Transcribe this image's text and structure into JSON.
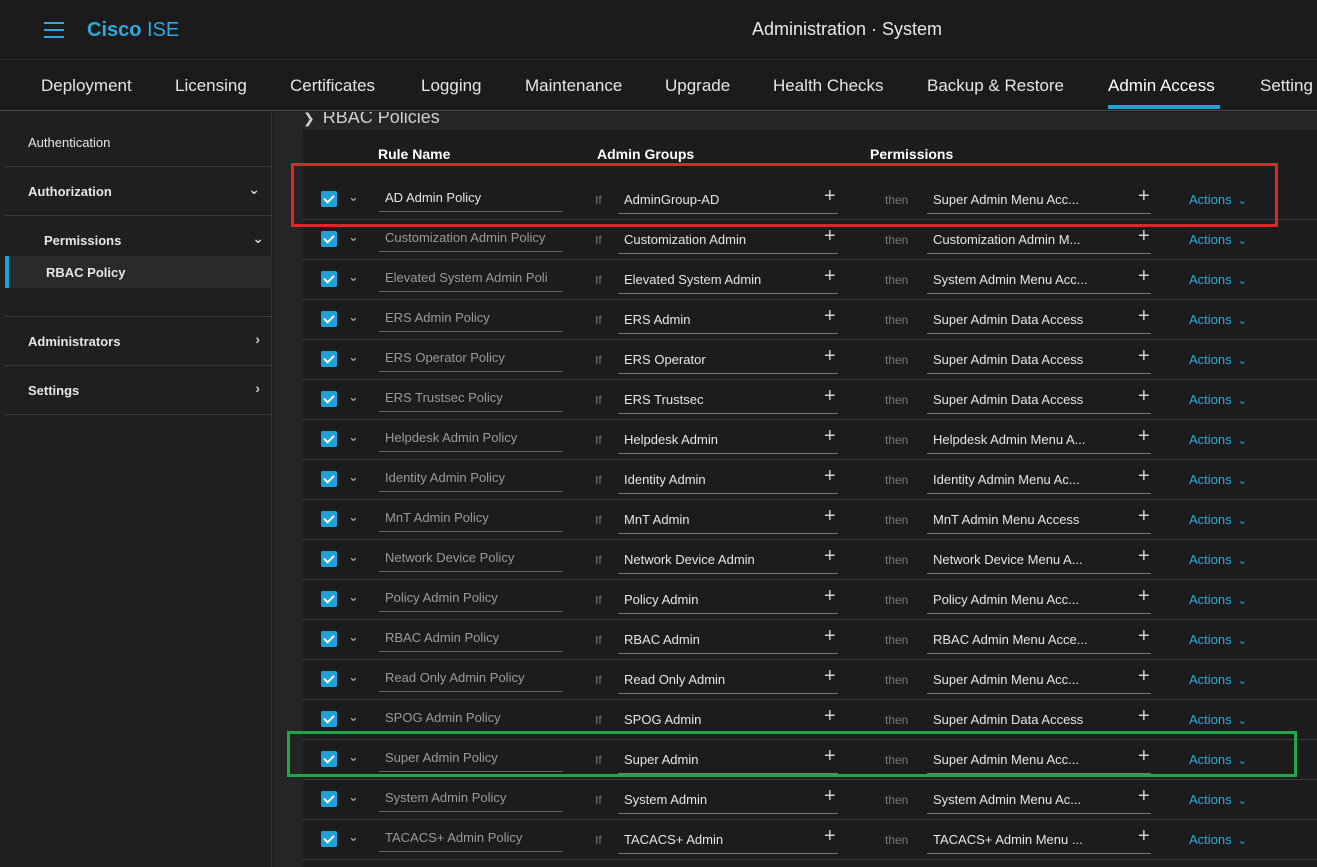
{
  "header": {
    "brand_bold": "Cisco",
    "brand_rest": "ISE",
    "title": "Administration · System"
  },
  "tabs": [
    {
      "label": "Deployment"
    },
    {
      "label": "Licensing"
    },
    {
      "label": "Certificates"
    },
    {
      "label": "Logging"
    },
    {
      "label": "Maintenance"
    },
    {
      "label": "Upgrade"
    },
    {
      "label": "Health Checks"
    },
    {
      "label": "Backup & Restore"
    },
    {
      "label": "Admin Access",
      "active": true
    },
    {
      "label": "Setting"
    }
  ],
  "sidebar": {
    "authentication": "Authentication",
    "authorization": "Authorization",
    "permissions": "Permissions",
    "rbac_policy": "RBAC Policy",
    "administrators": "Administrators",
    "settings": "Settings"
  },
  "main": {
    "section_title": "RBAC Policies",
    "columns": {
      "rule_name": "Rule Name",
      "admin_groups": "Admin Groups",
      "permissions": "Permissions"
    },
    "if_label": "If",
    "then_label": "then",
    "actions_label": "Actions",
    "rows": [
      {
        "name": "AD Admin Policy",
        "group": "AdminGroup-AD",
        "permission": "Super Admin Menu Acc...",
        "highlight": true
      },
      {
        "name": "Customization Admin Policy",
        "group": "Customization Admin",
        "permission": "Customization Admin M..."
      },
      {
        "name": "Elevated System Admin Poli",
        "group": "Elevated System Admin",
        "permission": "System Admin Menu Acc..."
      },
      {
        "name": "ERS Admin Policy",
        "group": "ERS Admin",
        "permission": "Super Admin Data Access"
      },
      {
        "name": "ERS Operator Policy",
        "group": "ERS Operator",
        "permission": "Super Admin Data Access"
      },
      {
        "name": "ERS Trustsec Policy",
        "group": "ERS Trustsec",
        "permission": "Super Admin Data Access"
      },
      {
        "name": "Helpdesk Admin Policy",
        "group": "Helpdesk Admin",
        "permission": "Helpdesk Admin Menu A..."
      },
      {
        "name": "Identity Admin Policy",
        "group": "Identity Admin",
        "permission": "Identity Admin Menu Ac..."
      },
      {
        "name": "MnT Admin Policy",
        "group": "MnT Admin",
        "permission": "MnT Admin Menu Access"
      },
      {
        "name": "Network Device Policy",
        "group": "Network Device Admin",
        "permission": "Network Device Menu A..."
      },
      {
        "name": "Policy Admin Policy",
        "group": "Policy Admin",
        "permission": "Policy Admin Menu Acc..."
      },
      {
        "name": "RBAC Admin Policy",
        "group": "RBAC Admin",
        "permission": "RBAC Admin Menu Acce..."
      },
      {
        "name": "Read Only Admin Policy",
        "group": "Read Only Admin",
        "permission": "Super Admin Menu Acc..."
      },
      {
        "name": "SPOG Admin Policy",
        "group": "SPOG Admin",
        "permission": "Super Admin Data Access"
      },
      {
        "name": "Super Admin Policy",
        "group": "Super Admin",
        "permission": "Super Admin Menu Acc..."
      },
      {
        "name": "System Admin Policy",
        "group": "System Admin",
        "permission": "System Admin Menu Ac..."
      },
      {
        "name": "TACACS+ Admin Policy",
        "group": "TACACS+ Admin",
        "permission": "TACACS+ Admin Menu ..."
      }
    ]
  },
  "colors": {
    "accent": "#1ea0d8",
    "highlight_red": "#e0242a",
    "highlight_green": "#1fa84a"
  }
}
